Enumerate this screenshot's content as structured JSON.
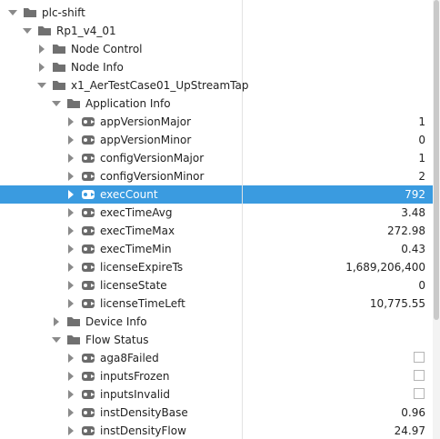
{
  "tree": {
    "root": "plc-shift",
    "device": "Rp1_v4_01",
    "node_control": "Node Control",
    "node_info": "Node Info",
    "test_case": "x1_AerTestCase01_UpStreamTap",
    "application_info": "Application Info",
    "device_info": "Device Info",
    "flow_status": "Flow Status",
    "app_tags": [
      {
        "label": "appVersionMajor",
        "value": "1"
      },
      {
        "label": "appVersionMinor",
        "value": "0"
      },
      {
        "label": "configVersionMajor",
        "value": "1"
      },
      {
        "label": "configVersionMinor",
        "value": "2"
      },
      {
        "label": "execCount",
        "value": "792"
      },
      {
        "label": "execTimeAvg",
        "value": "3.48"
      },
      {
        "label": "execTimeMax",
        "value": "272.98"
      },
      {
        "label": "execTimeMin",
        "value": "0.43"
      },
      {
        "label": "licenseExpireTs",
        "value": "1,689,206,400"
      },
      {
        "label": "licenseState",
        "value": "0"
      },
      {
        "label": "licenseTimeLeft",
        "value": "10,775.55"
      }
    ],
    "flow_tags": [
      {
        "label": "aga8Failed",
        "checked": false
      },
      {
        "label": "inputsFrozen",
        "checked": false
      },
      {
        "label": "inputsInvalid",
        "checked": false
      },
      {
        "label": "instDensityBase",
        "value": "0.96"
      },
      {
        "label": "instDensityFlow",
        "value": "24.97"
      }
    ]
  },
  "icons": {
    "expanded": "chevron-down-icon",
    "collapsed": "chevron-right-icon",
    "folder": "folder-icon",
    "tag": "tag-icon"
  },
  "colors": {
    "selection": "#3a9be0",
    "folder": "#707070",
    "tag": "#6b6b6b",
    "arrow": "#8a8a8a"
  }
}
